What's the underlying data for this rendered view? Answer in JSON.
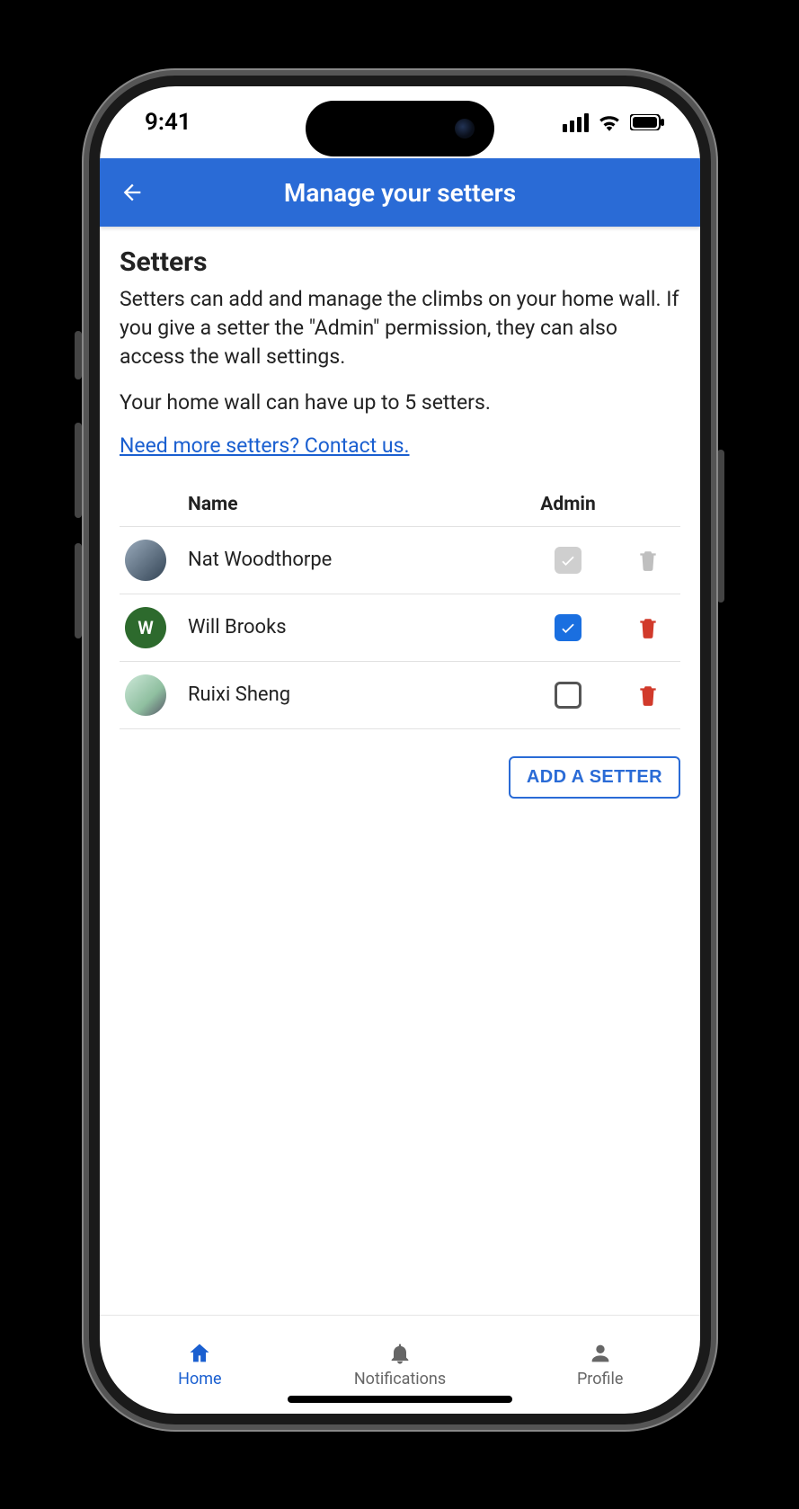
{
  "status": {
    "time": "9:41"
  },
  "header": {
    "title": "Manage your setters"
  },
  "section": {
    "title": "Setters",
    "desc1": "Setters can add and manage the climbs on your home wall. If you give a setter the \"Admin\" permission, they can also access the wall settings.",
    "desc2": "Your home wall can have up to 5 setters.",
    "link": "Need more setters? Contact us."
  },
  "table": {
    "col_name": "Name",
    "col_admin": "Admin",
    "rows": [
      {
        "name": "Nat Woodthorpe",
        "avatar_type": "photo1",
        "initial": "",
        "admin_state": "disabled",
        "delete_state": "gray"
      },
      {
        "name": "Will Brooks",
        "avatar_type": "green",
        "initial": "W",
        "admin_state": "checked",
        "delete_state": "red"
      },
      {
        "name": "Ruixi Sheng",
        "avatar_type": "photo2",
        "initial": "",
        "admin_state": "unchecked",
        "delete_state": "red"
      }
    ]
  },
  "actions": {
    "add": "ADD A SETTER"
  },
  "tabs": {
    "home": "Home",
    "notifications": "Notifications",
    "profile": "Profile"
  }
}
